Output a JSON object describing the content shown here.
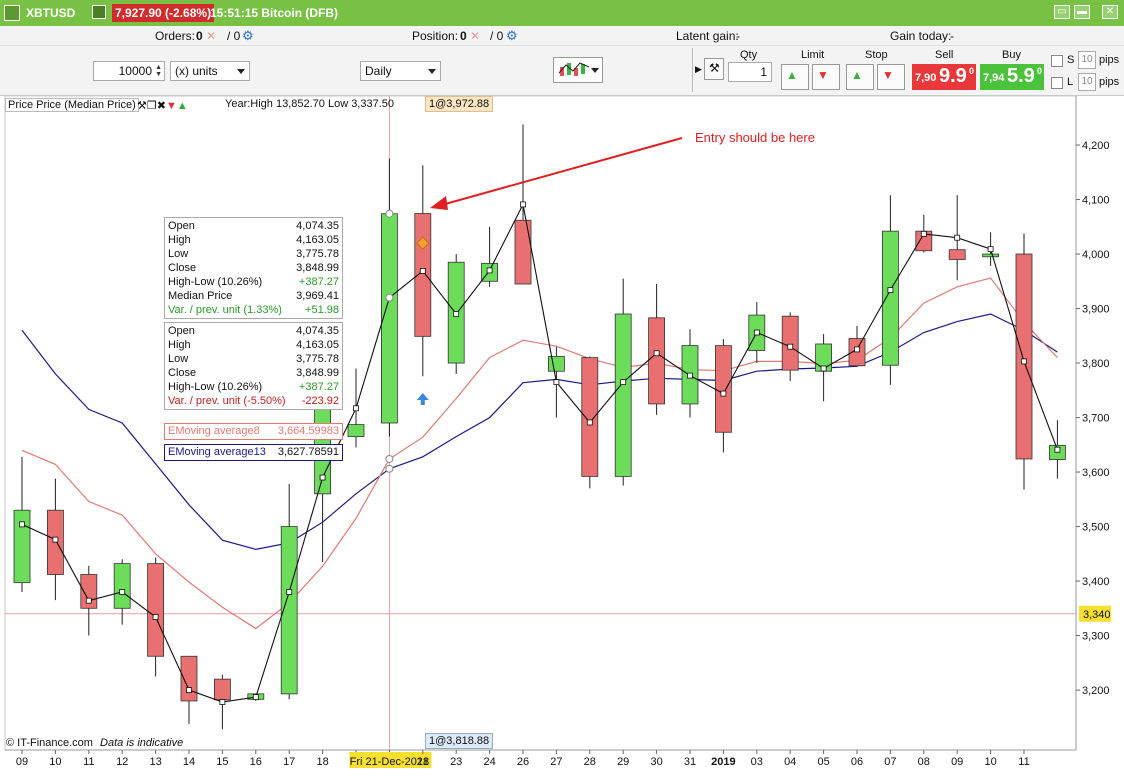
{
  "titlebar": {
    "symbol": "XBTUSD",
    "price_change": "7,927.90 (-2.68%)",
    "time_title": "15:51:15 Bitcoin (DFB)"
  },
  "orders_bar": {
    "orders_label": "Orders:",
    "orders_value": "0",
    "orders_sep": "/ 0",
    "position_label": "Position:",
    "position_value": "0",
    "position_sep": "/ 0",
    "latent_label": "Latent gain:",
    "latent_value": "-",
    "gain_today_label": "Gain today:",
    "gain_today_value": "-"
  },
  "controls": {
    "quantity": "10000",
    "units": "(x) units",
    "timeframe": "Daily",
    "qty_header": "Qty",
    "qty_value": "1",
    "limit_header": "Limit",
    "stop_header": "Stop",
    "sell_header": "Sell",
    "buy_header": "Buy",
    "sell_prefix": "7,90",
    "sell_big": "9.9",
    "sell_sup": "0",
    "buy_prefix": "7,94",
    "buy_big": "5.9",
    "buy_sup": "0",
    "s_label": "S",
    "l_label": "L",
    "pips_value": "10",
    "pips_label": "pips"
  },
  "chart_header": {
    "title": "Price Price (Median Price)",
    "year_range": "Year:High 13,852.70 Low 3,337.50",
    "crosshair_top": "1@3,972.88",
    "crosshair_bottom": "1@3,818.88",
    "watermark_left": "© IT-Finance.com",
    "watermark_right": "Data is indicative",
    "annotation": "Entry should be here"
  },
  "data_box_1": [
    {
      "label": "Open",
      "value": "4,074.35"
    },
    {
      "label": "High",
      "value": "4,163.05"
    },
    {
      "label": "Low",
      "value": "3,775.78"
    },
    {
      "label": "Close",
      "value": "3,848.99"
    },
    {
      "label": "High-Low (10.26%)",
      "value": "+387.27"
    },
    {
      "label": "Median Price",
      "value": "3,969.41"
    },
    {
      "label": "Var. / prev. unit (1.33%)",
      "value": "+51.98"
    }
  ],
  "data_box_2": [
    {
      "label": "Open",
      "value": "4,074.35"
    },
    {
      "label": "High",
      "value": "4,163.05"
    },
    {
      "label": "Low",
      "value": "3,775.78"
    },
    {
      "label": "Close",
      "value": "3,848.99"
    },
    {
      "label": "High-Low (10.26%)",
      "value": "+387.27"
    },
    {
      "label": "Var. / prev. unit (-5.50%)",
      "value": "-223.92"
    }
  ],
  "ema8": {
    "label": "EMoving average8",
    "value": "3,664.59983"
  },
  "ema13": {
    "label": "EMoving average13",
    "value": "3,627.78591"
  },
  "colors": {
    "up": "#6cdc5a",
    "down": "#e87070",
    "ema8": "#e07a72",
    "ema13": "#1a1a8a",
    "titlebar": "#79c145",
    "sell": "#e8383a",
    "buy": "#4cc23c"
  },
  "chart_data": {
    "type": "candlestick",
    "title": "Price Price (Median Price)",
    "categories": [
      "09",
      "10",
      "11",
      "12",
      "13",
      "14",
      "15",
      "16",
      "17",
      "18",
      "19",
      "Fri 21-Dec-2018",
      "21",
      "23",
      "24",
      "26",
      "27",
      "28",
      "29",
      "30",
      "31",
      "2019",
      "03",
      "04",
      "05",
      "06",
      "07",
      "08",
      "09",
      "10",
      "11"
    ],
    "highlight_category": "Fri 21-Dec-2018",
    "ylim": [
      3090,
      4290
    ],
    "yticks": [
      3200,
      3300,
      3400,
      3500,
      3600,
      3700,
      3800,
      3900,
      4000,
      4100,
      4200
    ],
    "ytick_labels": [
      "3,200",
      "3,300",
      "3,400",
      "3,500",
      "3,600",
      "3,700",
      "3,800",
      "3,900",
      "4,000",
      "4,100",
      "4,200"
    ],
    "last_price_marker": {
      "value": 3340,
      "label": "3,340"
    },
    "candles": [
      {
        "o": 3397,
        "h": 3628,
        "l": 3380,
        "c": 3530
      },
      {
        "o": 3530,
        "h": 3588,
        "l": 3365,
        "c": 3412
      },
      {
        "o": 3412,
        "h": 3428,
        "l": 3300,
        "c": 3350
      },
      {
        "o": 3350,
        "h": 3440,
        "l": 3320,
        "c": 3432
      },
      {
        "o": 3432,
        "h": 3443,
        "l": 3225,
        "c": 3262
      },
      {
        "o": 3262,
        "h": 3262,
        "l": 3138,
        "c": 3180
      },
      {
        "o": 3220,
        "h": 3228,
        "l": 3128,
        "c": 3182
      },
      {
        "o": 3183,
        "h": 3193,
        "l": 3180,
        "c": 3193
      },
      {
        "o": 3193,
        "h": 3578,
        "l": 3183,
        "c": 3500
      },
      {
        "o": 3560,
        "h": 3745,
        "l": 3435,
        "c": 3740
      },
      {
        "o": 3665,
        "h": 3790,
        "l": 3645,
        "c": 3687
      },
      {
        "o": 3690,
        "h": 4175,
        "l": 3665,
        "c": 4074
      },
      {
        "o": 4074.35,
        "h": 4163.05,
        "l": 3775.78,
        "c": 3848.99
      },
      {
        "o": 3800,
        "h": 4000,
        "l": 3780,
        "c": 3985
      },
      {
        "o": 3950,
        "h": 4050,
        "l": 3940,
        "c": 3983
      },
      {
        "o": 4062,
        "h": 4238,
        "l": 3945,
        "c": 3945
      },
      {
        "o": 3785,
        "h": 3830,
        "l": 3700,
        "c": 3812
      },
      {
        "o": 3810,
        "h": 3812,
        "l": 3570,
        "c": 3592
      },
      {
        "o": 3592,
        "h": 3955,
        "l": 3575,
        "c": 3890
      },
      {
        "o": 3883,
        "h": 3945,
        "l": 3705,
        "c": 3725
      },
      {
        "o": 3725,
        "h": 3862,
        "l": 3700,
        "c": 3832
      },
      {
        "o": 3832,
        "h": 3844,
        "l": 3636,
        "c": 3673
      },
      {
        "o": 3823,
        "h": 3912,
        "l": 3800,
        "c": 3888
      },
      {
        "o": 3886,
        "h": 3893,
        "l": 3767,
        "c": 3787
      },
      {
        "o": 3785,
        "h": 3853,
        "l": 3730,
        "c": 3835
      },
      {
        "o": 3845,
        "h": 3868,
        "l": 3795,
        "c": 3795
      },
      {
        "o": 3796,
        "h": 4108,
        "l": 3760,
        "c": 4042
      },
      {
        "o": 4042,
        "h": 4072,
        "l": 4003,
        "c": 4006
      },
      {
        "o": 4008,
        "h": 4108,
        "l": 3952,
        "c": 3990
      },
      {
        "o": 3995,
        "h": 4040,
        "l": 3978,
        "c": 4000
      },
      {
        "o": 4000,
        "h": 4038,
        "l": 3568,
        "c": 3624
      },
      {
        "o": 3623,
        "h": 3695,
        "l": 3588,
        "c": 3649
      }
    ],
    "series": [
      {
        "name": "Median Price",
        "values": [
          3504,
          3476,
          3364,
          3380,
          3334,
          3200,
          3178,
          3187,
          3380,
          3590,
          3717,
          3920,
          3969,
          3890,
          3970,
          4091,
          3765,
          3691,
          3765,
          3818,
          3777,
          3744,
          3856,
          3830,
          3790,
          3825,
          3934,
          4037,
          4030,
          4009,
          3803,
          3641
        ]
      },
      {
        "name": "EMoving average8",
        "values": [
          3640,
          3614,
          3546,
          3521,
          3450,
          3398,
          3352,
          3313,
          3360,
          3427,
          3515,
          3624,
          3664,
          3735,
          3810,
          3842,
          3831,
          3808,
          3792,
          3800,
          3788,
          3786,
          3803,
          3803,
          3799,
          3805,
          3846,
          3910,
          3940,
          3956,
          3875,
          3810
        ]
      },
      {
        "name": "EMoving average13",
        "values": [
          3860,
          3780,
          3715,
          3690,
          3615,
          3540,
          3475,
          3458,
          3470,
          3508,
          3560,
          3606,
          3628,
          3665,
          3700,
          3764,
          3770,
          3760,
          3767,
          3772,
          3770,
          3768,
          3785,
          3789,
          3791,
          3794,
          3820,
          3856,
          3876,
          3890,
          3860,
          3820
        ]
      }
    ]
  }
}
